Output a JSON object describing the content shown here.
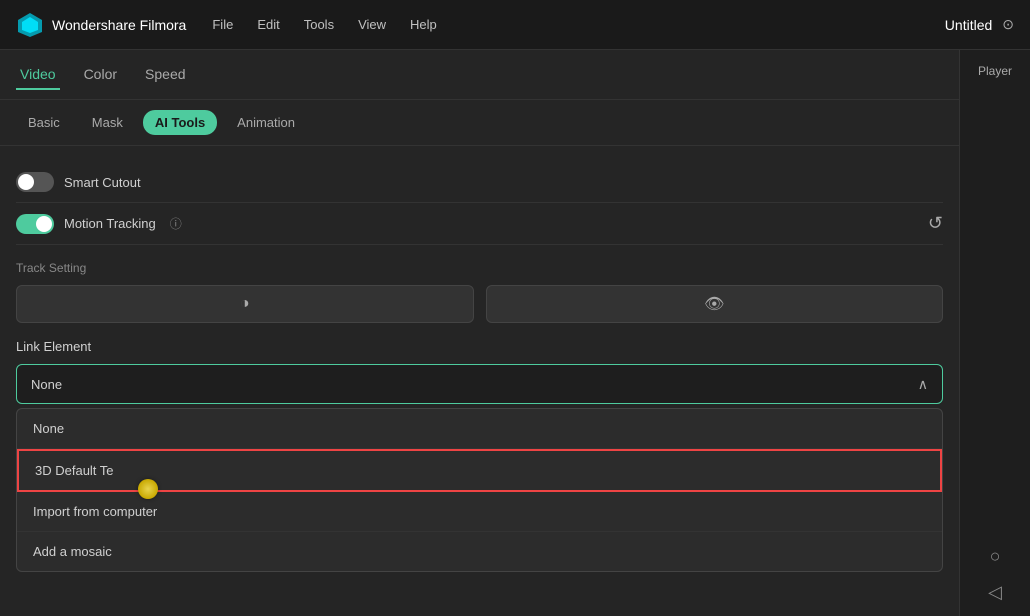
{
  "app": {
    "name": "Wondershare Filmora"
  },
  "topbar": {
    "project_name": "Untitled",
    "menu_items": [
      "File",
      "Edit",
      "Tools",
      "View",
      "Help"
    ]
  },
  "tabs": {
    "main": [
      {
        "label": "Video",
        "active": true
      },
      {
        "label": "Color",
        "active": false
      },
      {
        "label": "Speed",
        "active": false
      }
    ],
    "sub": [
      {
        "label": "Basic",
        "active": false
      },
      {
        "label": "Mask",
        "active": false
      },
      {
        "label": "AI Tools",
        "active": true
      },
      {
        "label": "Animation",
        "active": false
      }
    ]
  },
  "toggles": {
    "smart_cutout": {
      "label": "Smart Cutout",
      "on": false
    },
    "motion_tracking": {
      "label": "Motion Tracking",
      "on": true
    }
  },
  "track_setting": {
    "label": "Track Setting"
  },
  "link_element": {
    "label": "Link Element",
    "selected": "None",
    "options": [
      {
        "value": "None",
        "label": "None"
      },
      {
        "value": "3d_default",
        "label": "3D Default Te",
        "highlighted": true
      },
      {
        "value": "import",
        "label": "Import from computer"
      },
      {
        "value": "mosaic",
        "label": "Add a mosaic"
      }
    ]
  },
  "player": {
    "label": "Player"
  },
  "icons": {
    "logo_diamond": "◆",
    "chevron_down": "⌄",
    "reset": "↺",
    "info": "?",
    "circle_half": "◑",
    "eye": "👁",
    "triangle_right": "◁"
  }
}
